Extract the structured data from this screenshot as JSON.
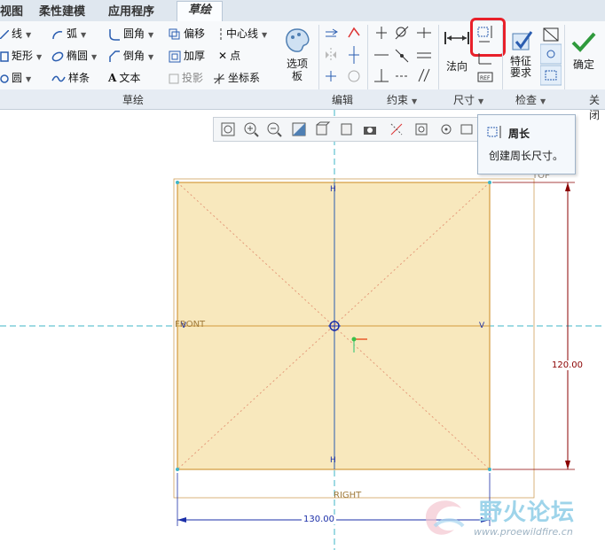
{
  "tabs": [
    "视图",
    "柔性建模",
    "应用程序",
    "草绘"
  ],
  "ribbon": {
    "sketch": {
      "line": "线",
      "arc": "弧",
      "fillet": "圆角",
      "offset": "偏移",
      "centerline": "中心线",
      "rectangle": "矩形",
      "ellipse": "椭圆",
      "chamfer": "倒角",
      "thicken": "加厚",
      "point": "点",
      "circle": "圆",
      "spline": "样条",
      "text": "文本",
      "project": "投影",
      "coord_system": "坐标系",
      "palette": "选项板"
    },
    "normal": "法向",
    "feature_requirements": "特征要求",
    "ok": "确定"
  },
  "groups": {
    "sketch": "草绘",
    "edit": "编辑",
    "constrain": "约束",
    "dimension": "尺寸",
    "inspect": "检查",
    "close": "关闭"
  },
  "tooltip": {
    "title": "周长",
    "description": "创建周长尺寸。"
  },
  "canvas": {
    "label_top": "TOP",
    "label_front": "FRONT",
    "label_right": "RIGHT",
    "dim_height": "120.00",
    "dim_width": "130.00",
    "constraint_h": "H",
    "constraint_v": "V"
  },
  "watermark": {
    "name": "野火论坛",
    "url": "www.proewildfire.cn"
  },
  "colors": {
    "rect_fill": "#f8e8bd",
    "rect_stroke": "#d39a3c",
    "dimension": "#8b0000",
    "centerline": "#3fb5c7",
    "highlight": "#e8202a"
  }
}
